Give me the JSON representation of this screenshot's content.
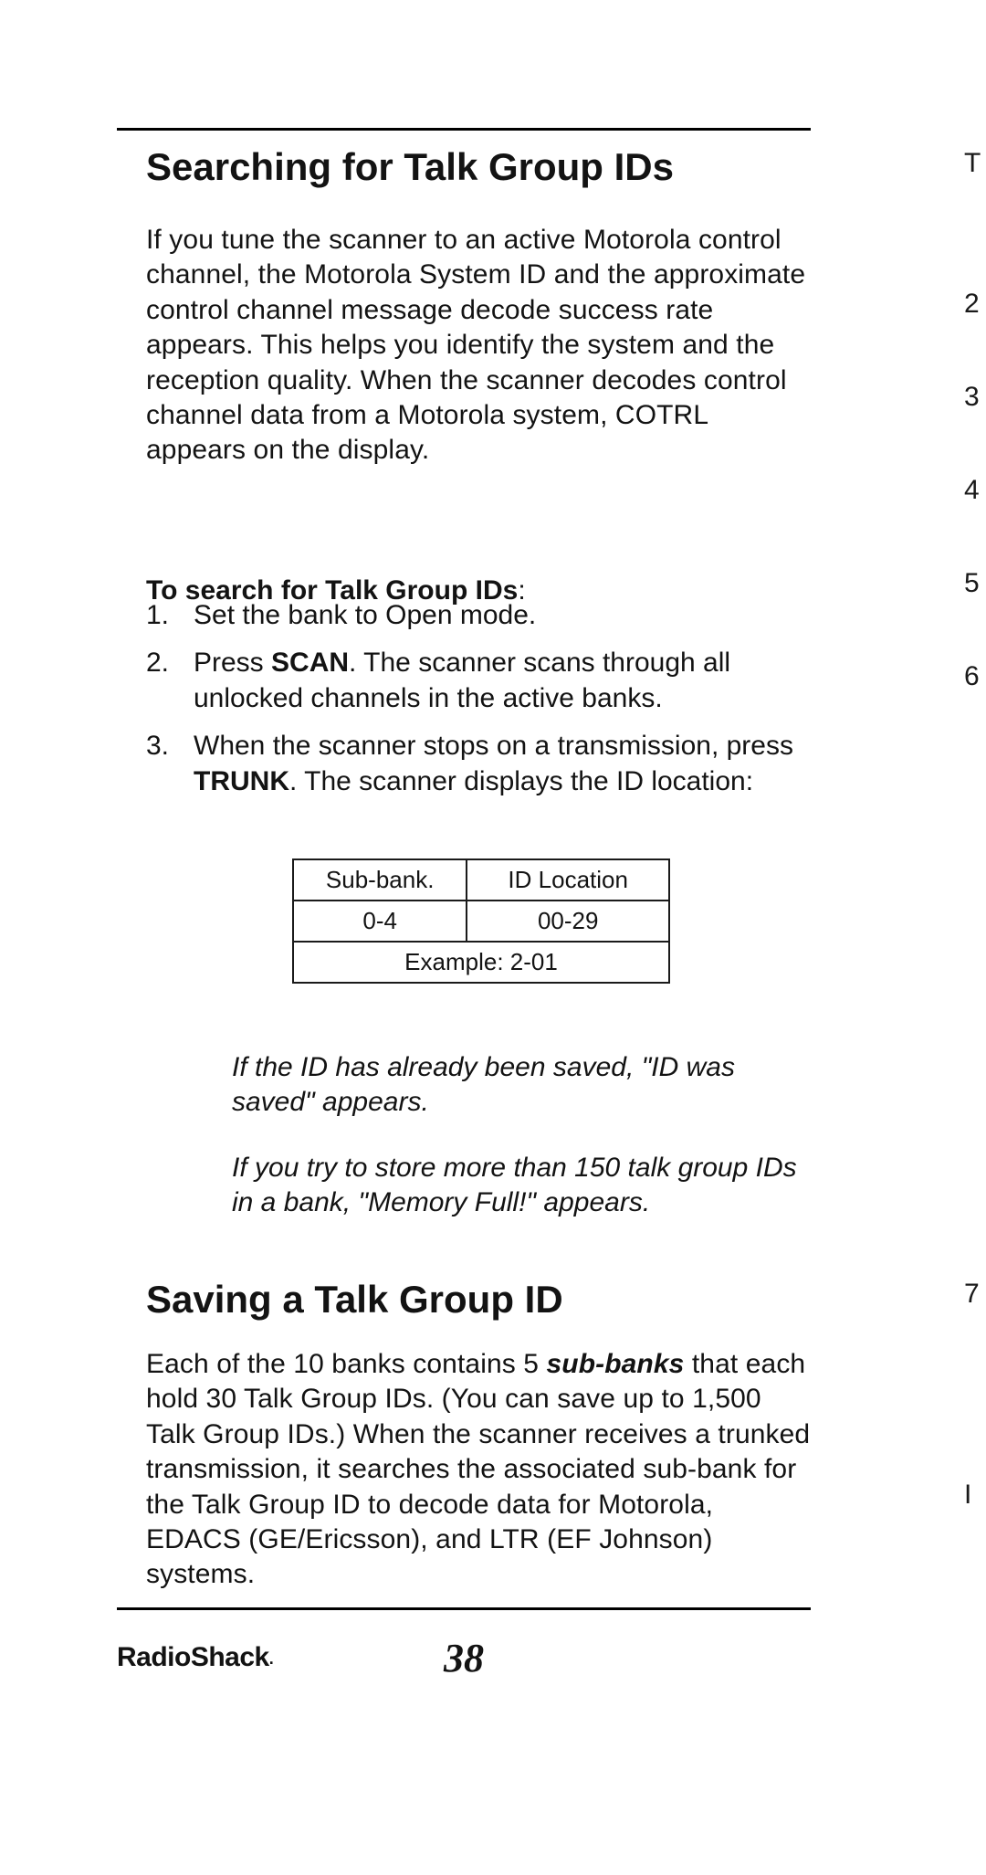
{
  "rule_top": "",
  "rule_bottom": "",
  "section1": {
    "heading": "Searching for Talk Group IDs",
    "para": "If you tune the scanner to an active Motorola control channel, the Motorola System ID and the approximate control channel message decode success rate appears. This helps you identify the system and the reception quality. When the scanner decodes control channel data from a Motorola system, COTRL appears on the display.",
    "to_label_bold": "To search for Talk Group IDs",
    "to_label_colon": ":",
    "steps": {
      "n1": "1.",
      "t1": "Set the bank to Open mode.",
      "n2": "2.",
      "t2a": "Press ",
      "t2b": "SCAN",
      "t2c": ". The scanner scans through all unlocked channels in the active banks.",
      "n3": "3.",
      "t3a": "When the scanner stops on a transmission, press ",
      "t3b": "TRUNK",
      "t3c": ". The scanner displays the ID location:"
    },
    "table": {
      "h1": "Sub-bank.",
      "h2": "ID Location",
      "r1c1": "0-4",
      "r1c2": "00-29",
      "ex": "Example: 2-01"
    },
    "note1": "If the ID has already been saved, \"ID was saved\" appears.",
    "note2": "If you try to store more than 150 talk group IDs in a bank, \"Memory Full!\" appears."
  },
  "section2": {
    "heading": "Saving a Talk Group ID",
    "para_a": "Each of the 10 banks contains 5 ",
    "para_b": "sub-banks",
    "para_c": " that each hold 30 Talk Group IDs. (You can save up to 1,500 Talk Group IDs.) When the scanner receives a trunked transmission, it searches the associated sub-bank for the Talk Group ID to decode data for Motorola, EDACS (GE/Ericsson), and LTR (EF Johnson) systems."
  },
  "footer": {
    "brand": "RadioShack",
    "brand_dot": ".",
    "page": "38"
  },
  "edge": {
    "e1": "T",
    "e2": "2",
    "e3": "3",
    "e4": "4",
    "e5": "5",
    "e6": "6",
    "e7": "7",
    "e8": "I"
  }
}
